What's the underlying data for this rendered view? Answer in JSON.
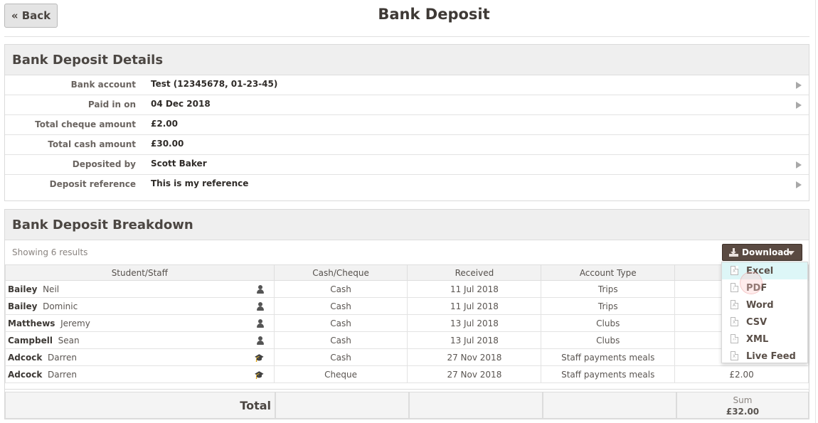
{
  "header": {
    "back_label": "« Back",
    "title": "Bank Deposit"
  },
  "details": {
    "heading": "Bank Deposit Details",
    "rows": [
      {
        "label": "Bank account",
        "value": "Test (12345678, 01-23-45)"
      },
      {
        "label": "Paid in on",
        "value": "04 Dec 2018"
      },
      {
        "label": "Total cheque amount",
        "value": "£2.00"
      },
      {
        "label": "Total cash amount",
        "value": "£30.00"
      },
      {
        "label": "Deposited by",
        "value": "Scott Baker"
      },
      {
        "label": "Deposit reference",
        "value": "This is my reference"
      }
    ]
  },
  "breakdown": {
    "heading": "Bank Deposit Breakdown",
    "showing_text": "Showing 6 results",
    "download_label": "Download",
    "columns": [
      "Student/Staff",
      "Cash/Cheque",
      "Received",
      "Account Type",
      ""
    ],
    "rows": [
      {
        "surname": "Bailey",
        "forename": "Neil",
        "icon": "person-icon",
        "method": "Cash",
        "received": "11 Jul 2018",
        "account_type": "Trips",
        "amount": ""
      },
      {
        "surname": "Bailey",
        "forename": "Dominic",
        "icon": "person-icon",
        "method": "Cash",
        "received": "11 Jul 2018",
        "account_type": "Trips",
        "amount": ""
      },
      {
        "surname": "Matthews",
        "forename": "Jeremy",
        "icon": "person-icon",
        "method": "Cash",
        "received": "13 Jul 2018",
        "account_type": "Clubs",
        "amount": ""
      },
      {
        "surname": "Campbell",
        "forename": "Sean",
        "icon": "person-icon",
        "method": "Cash",
        "received": "13 Jul 2018",
        "account_type": "Clubs",
        "amount": ""
      },
      {
        "surname": "Adcock",
        "forename": "Darren",
        "icon": "graduation-cap-icon",
        "method": "Cash",
        "received": "27 Nov 2018",
        "account_type": "Staff payments meals",
        "amount": ""
      },
      {
        "surname": "Adcock",
        "forename": "Darren",
        "icon": "graduation-cap-icon",
        "method": "Cheque",
        "received": "27 Nov 2018",
        "account_type": "Staff payments meals",
        "amount": "£2.00"
      }
    ],
    "total_label": "Total",
    "sum_label": "Sum",
    "sum_value": "£32.00"
  },
  "download_menu": {
    "items": [
      {
        "label": "Excel",
        "icon": "excel-file-icon",
        "glyph": "X"
      },
      {
        "label": "PDF",
        "icon": "pdf-file-icon",
        "glyph": "♪"
      },
      {
        "label": "Word",
        "icon": "word-file-icon",
        "glyph": "A"
      },
      {
        "label": "CSV",
        "icon": "csv-file-icon",
        "glyph": "X"
      },
      {
        "label": "XML",
        "icon": "xml-file-icon",
        "glyph": "‹›"
      },
      {
        "label": "Live Feed",
        "icon": "live-feed-file-icon",
        "glyph": "X"
      }
    ]
  }
}
